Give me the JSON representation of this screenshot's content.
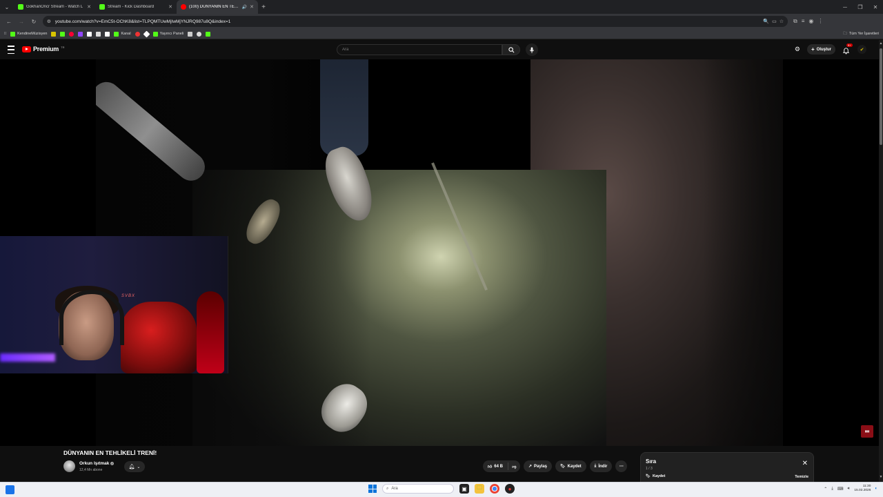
{
  "browser": {
    "tabs": [
      {
        "title": "GokhanOncr Stream - Watch L",
        "favicon_color": "#53fc18",
        "active": false
      },
      {
        "title": "Stream - Kick Dashboard",
        "favicon_color": "#53fc18",
        "active": false
      },
      {
        "title": "(100) DÜNYANIN EN TEHLİ",
        "favicon_color": "#ff0000",
        "active": true
      }
    ],
    "new_tab_icon": "plus-icon",
    "url": "youtube.com/watch?v=EmC5t-OChK8&list=TLPQMTUwMjIwMjYNJRQ987u8Q&index=1",
    "bookmarks": [
      {
        "label": "KendineMüzisyen",
        "color": "#53fc18"
      },
      {
        "label": "",
        "color": "#d8c400"
      },
      {
        "label": "",
        "color": "#53fc18"
      },
      {
        "label": "",
        "color": "#ff0033"
      },
      {
        "label": "",
        "color": "#9146ff"
      },
      {
        "label": "",
        "color": "#ffffff"
      },
      {
        "label": "",
        "color": "#ffffff"
      },
      {
        "label": "",
        "color": "#ffffff"
      },
      {
        "label": "Kanal",
        "color": "#53fc18"
      },
      {
        "label": "",
        "color": "#e33"
      },
      {
        "label": "",
        "color": "#ffffff"
      },
      {
        "label": "Yayıncı Paneli",
        "color": "#53fc18"
      },
      {
        "label": "",
        "color": "#ffffff"
      },
      {
        "label": "",
        "color": "#ffffff"
      },
      {
        "label": "",
        "color": "#53fc18"
      }
    ],
    "bookmarks_right": "Tüm Yer İşaretleri"
  },
  "youtube": {
    "logo_text": "Premium",
    "logo_sup": "TR",
    "search_placeholder": "Ara",
    "create_label": "Oluştur",
    "notification_count": "9+"
  },
  "video": {
    "title": "DÜNYANIN EN TEHLİKELİ TRENİ!",
    "channel_name": "Orkun Işıtmak",
    "subscribers": "12,4 Mn abone",
    "likes": "64 B",
    "share_label": "Paylaş",
    "save_label": "Kaydet",
    "download_label": "İndir",
    "webcam_logo": "SVBX"
  },
  "queue": {
    "title": "Sıra",
    "count": "1 / 3",
    "save_label": "Kaydet",
    "clear_label": "Temizle"
  },
  "taskbar": {
    "search_placeholder": "Ara",
    "time": "11:30",
    "date": "15.02.2026"
  }
}
